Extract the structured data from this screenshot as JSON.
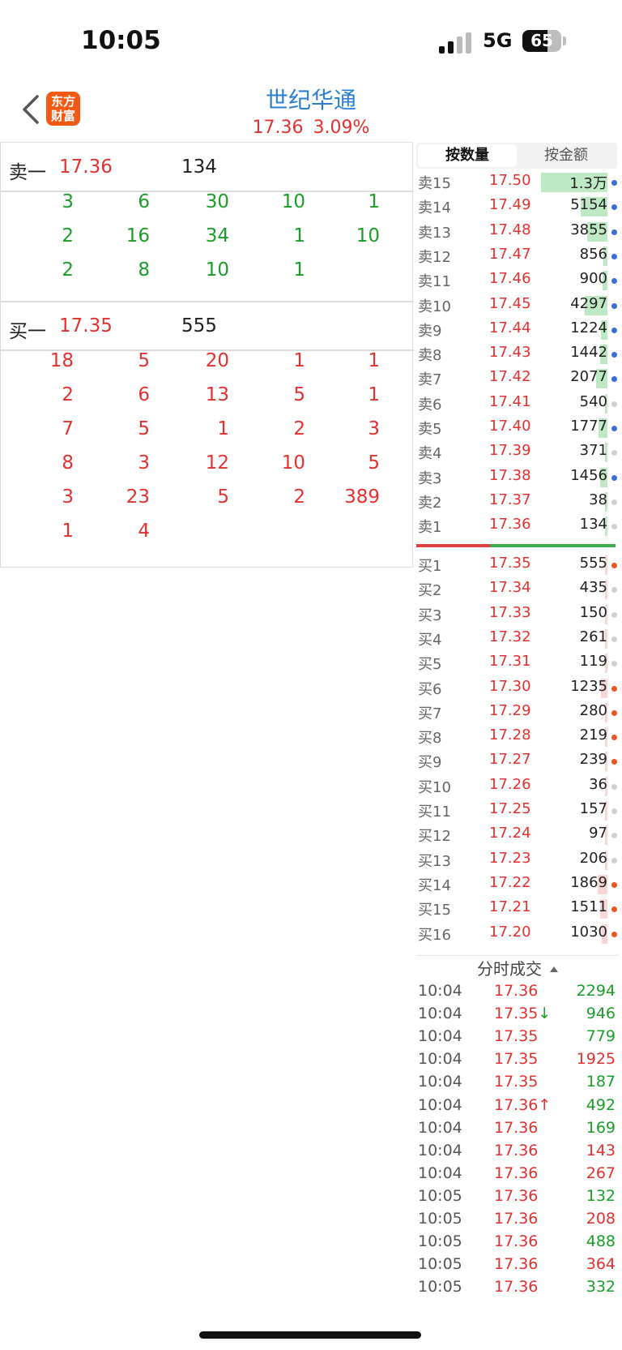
{
  "status_bar": {
    "time": "10:05",
    "network": "5G",
    "battery": "65",
    "battery_level": 0.65
  },
  "header": {
    "title": "世纪华通",
    "price": "17.36",
    "change_pct": "3.09%",
    "logo_line1": "东方",
    "logo_line2": "财富"
  },
  "left_panel": {
    "sell": {
      "label": "卖一",
      "price": "17.36",
      "volume": "134",
      "queue": [
        [
          "3",
          "6",
          "30",
          "10",
          "1"
        ],
        [
          "2",
          "16",
          "34",
          "1",
          "10"
        ],
        [
          "2",
          "8",
          "10",
          "1",
          ""
        ]
      ]
    },
    "buy": {
      "label": "买一",
      "price": "17.35",
      "volume": "555",
      "queue": [
        [
          "18",
          "5",
          "20",
          "1",
          "1"
        ],
        [
          "2",
          "6",
          "13",
          "5",
          "1"
        ],
        [
          "7",
          "5",
          "1",
          "2",
          "3"
        ],
        [
          "8",
          "3",
          "12",
          "10",
          "5"
        ],
        [
          "3",
          "23",
          "5",
          "2",
          "389"
        ],
        [
          "1",
          "4",
          "",
          "",
          ""
        ]
      ]
    }
  },
  "tabs": [
    "按数量",
    "按金额"
  ],
  "colors": {
    "up": "#e53030",
    "down": "#1a9e28",
    "brand": "#f25a16",
    "title": "#2a7fd4",
    "dot_blue": "#3a6fd8",
    "dot_orange": "#ee5522",
    "dot_gray": "#d0d0d0",
    "bar_green": "#bfe8c4",
    "bar_red": "#f9d6d6"
  },
  "asks": [
    {
      "label": "卖15",
      "price": "17.50",
      "qty": "1.3万",
      "dot": "blue",
      "level": 0.95
    },
    {
      "label": "卖14",
      "price": "17.49",
      "qty": "5154",
      "dot": "blue",
      "level": 0.38
    },
    {
      "label": "卖13",
      "price": "17.48",
      "qty": "3855",
      "dot": "blue",
      "level": 0.29
    },
    {
      "label": "卖12",
      "price": "17.47",
      "qty": "856",
      "dot": "blue",
      "level": 0.06
    },
    {
      "label": "卖11",
      "price": "17.46",
      "qty": "900",
      "dot": "blue",
      "level": 0.07
    },
    {
      "label": "卖10",
      "price": "17.45",
      "qty": "4297",
      "dot": "blue",
      "level": 0.32
    },
    {
      "label": "卖9",
      "price": "17.44",
      "qty": "1224",
      "dot": "blue",
      "level": 0.09
    },
    {
      "label": "卖8",
      "price": "17.43",
      "qty": "1442",
      "dot": "blue",
      "level": 0.11
    },
    {
      "label": "卖7",
      "price": "17.42",
      "qty": "2077",
      "dot": "blue",
      "level": 0.16
    },
    {
      "label": "卖6",
      "price": "17.41",
      "qty": "540",
      "dot": "gray",
      "level": 0.04
    },
    {
      "label": "卖5",
      "price": "17.40",
      "qty": "1777",
      "dot": "blue",
      "level": 0.13
    },
    {
      "label": "卖4",
      "price": "17.39",
      "qty": "371",
      "dot": "gray",
      "level": 0.03
    },
    {
      "label": "卖3",
      "price": "17.38",
      "qty": "1456",
      "dot": "blue",
      "level": 0.11
    },
    {
      "label": "卖2",
      "price": "17.37",
      "qty": "38",
      "dot": "gray",
      "level": 0.01
    },
    {
      "label": "卖1",
      "price": "17.36",
      "qty": "134",
      "dot": "gray",
      "level": 0.01
    }
  ],
  "bids": [
    {
      "label": "买1",
      "price": "17.35",
      "qty": "555",
      "dot": "orange",
      "level": 0.04
    },
    {
      "label": "买2",
      "price": "17.34",
      "qty": "435",
      "dot": "gray",
      "level": 0.03
    },
    {
      "label": "买3",
      "price": "17.33",
      "qty": "150",
      "dot": "gray",
      "level": 0.01
    },
    {
      "label": "买4",
      "price": "17.32",
      "qty": "261",
      "dot": "gray",
      "level": 0.02
    },
    {
      "label": "买5",
      "price": "17.31",
      "qty": "119",
      "dot": "gray",
      "level": 0.01
    },
    {
      "label": "买6",
      "price": "17.30",
      "qty": "1235",
      "dot": "orange",
      "level": 0.09
    },
    {
      "label": "买7",
      "price": "17.29",
      "qty": "280",
      "dot": "orange",
      "level": 0.02
    },
    {
      "label": "买8",
      "price": "17.28",
      "qty": "219",
      "dot": "orange",
      "level": 0.02
    },
    {
      "label": "买9",
      "price": "17.27",
      "qty": "239",
      "dot": "orange",
      "level": 0.02
    },
    {
      "label": "买10",
      "price": "17.26",
      "qty": "36",
      "dot": "gray",
      "level": 0.01
    },
    {
      "label": "买11",
      "price": "17.25",
      "qty": "157",
      "dot": "gray",
      "level": 0.01
    },
    {
      "label": "买12",
      "price": "17.24",
      "qty": "97",
      "dot": "gray",
      "level": 0.01
    },
    {
      "label": "买13",
      "price": "17.23",
      "qty": "206",
      "dot": "gray",
      "level": 0.02
    },
    {
      "label": "买14",
      "price": "17.22",
      "qty": "1869",
      "dot": "orange",
      "level": 0.14
    },
    {
      "label": "买15",
      "price": "17.21",
      "qty": "1511",
      "dot": "orange",
      "level": 0.11
    },
    {
      "label": "买16",
      "price": "17.20",
      "qty": "1030",
      "dot": "orange",
      "level": 0.08
    }
  ],
  "trades_title": "分时成交",
  "trades": [
    {
      "time": "10:04",
      "price": "17.36",
      "arrow": "",
      "vol": "2294",
      "dir": "down"
    },
    {
      "time": "10:04",
      "price": "17.35",
      "arrow": "↓",
      "vol": "946",
      "dir": "down"
    },
    {
      "time": "10:04",
      "price": "17.35",
      "arrow": "",
      "vol": "779",
      "dir": "down"
    },
    {
      "time": "10:04",
      "price": "17.35",
      "arrow": "",
      "vol": "1925",
      "dir": "up"
    },
    {
      "time": "10:04",
      "price": "17.35",
      "arrow": "",
      "vol": "187",
      "dir": "down"
    },
    {
      "time": "10:04",
      "price": "17.36",
      "arrow": "↑",
      "vol": "492",
      "dir": "down"
    },
    {
      "time": "10:04",
      "price": "17.36",
      "arrow": "",
      "vol": "169",
      "dir": "down"
    },
    {
      "time": "10:04",
      "price": "17.36",
      "arrow": "",
      "vol": "143",
      "dir": "up"
    },
    {
      "time": "10:04",
      "price": "17.36",
      "arrow": "",
      "vol": "267",
      "dir": "up"
    },
    {
      "time": "10:05",
      "price": "17.36",
      "arrow": "",
      "vol": "132",
      "dir": "down"
    },
    {
      "time": "10:05",
      "price": "17.36",
      "arrow": "",
      "vol": "208",
      "dir": "up"
    },
    {
      "time": "10:05",
      "price": "17.36",
      "arrow": "",
      "vol": "488",
      "dir": "down"
    },
    {
      "time": "10:05",
      "price": "17.36",
      "arrow": "",
      "vol": "364",
      "dir": "up"
    },
    {
      "time": "10:05",
      "price": "17.36",
      "arrow": "",
      "vol": "332",
      "dir": "down"
    }
  ]
}
